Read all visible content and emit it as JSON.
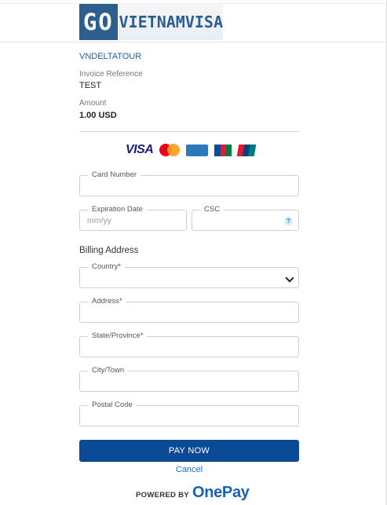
{
  "logo": {
    "part1": "GO",
    "part2": "VIETNAMVISA"
  },
  "merchant": "VNDELTATOUR",
  "invoice": {
    "label": "Invoice Reference",
    "value": "TEST"
  },
  "amount": {
    "label": "Amount",
    "value": "1.00 USD"
  },
  "card_brands": {
    "visa": "VISA",
    "icons": [
      "mastercard-icon",
      "amex-icon",
      "jcb-icon",
      "unionpay-icon"
    ]
  },
  "fields": {
    "card_number": {
      "label": "Card Number",
      "value": ""
    },
    "expiration": {
      "label": "Expiration Date",
      "placeholder": "mm/yy",
      "value": ""
    },
    "csc": {
      "label": "CSC",
      "help": "?",
      "value": ""
    }
  },
  "billing": {
    "title": "Billing Address",
    "country": {
      "label": "Country*",
      "value": ""
    },
    "address": {
      "label": "Address*",
      "value": ""
    },
    "state": {
      "label": "State/Province*",
      "value": ""
    },
    "city": {
      "label": "City/Town",
      "value": ""
    },
    "postal": {
      "label": "Postal Code",
      "value": ""
    }
  },
  "actions": {
    "pay": "PAY NOW",
    "cancel": "Cancel"
  },
  "footer": {
    "powered_by": "POWERED BY",
    "brand": "OnePay"
  },
  "colors": {
    "primary": "#0a4a96",
    "link": "#1f6fbf",
    "logo_blue": "#2d5f8e"
  }
}
